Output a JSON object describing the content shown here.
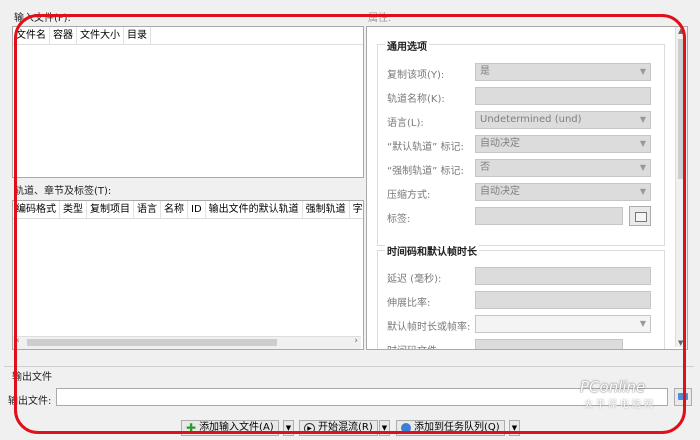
{
  "input_files": {
    "label": "输入文件(F):",
    "columns": [
      "文件名",
      "容器",
      "文件大小",
      "目录"
    ]
  },
  "tracks": {
    "label": "轨道、章节及标签(T):",
    "columns": [
      "编码格式",
      "类型",
      "复制项目",
      "语言",
      "名称",
      "ID",
      "输出文件的默认轨道",
      "强制轨道",
      "字"
    ]
  },
  "properties": {
    "label": "属性:",
    "general": {
      "title": "通用选项",
      "rows": [
        {
          "label": "复制该项(Y):",
          "value": "是",
          "dropdown": true
        },
        {
          "label": "轨道名称(K):",
          "value": "",
          "dropdown": false
        },
        {
          "label": "语言(L):",
          "value": "Undetermined (und)",
          "dropdown": true
        },
        {
          "label": "“默认轨道” 标记:",
          "value": "自动决定",
          "dropdown": true
        },
        {
          "label": "“强制轨道” 标记:",
          "value": "否",
          "dropdown": true
        },
        {
          "label": "压缩方式:",
          "value": "自动决定",
          "dropdown": true
        },
        {
          "label": "标签:",
          "value": "",
          "dropdown": false
        }
      ]
    },
    "timing": {
      "title": "时间码和默认帧时长",
      "rows": [
        {
          "label": "延迟 (毫秒):",
          "value": ""
        },
        {
          "label": "伸展比率:",
          "value": ""
        },
        {
          "label": "默认帧时长或帧率:",
          "value": ""
        },
        {
          "label": "时间码文件:",
          "value": ""
        }
      ]
    }
  },
  "output": {
    "group_label": "输出文件",
    "file_label": "输出文件:",
    "file_value": ""
  },
  "buttons": {
    "add_input": "添加输入文件(A)",
    "start_mux": "开始混流(R)",
    "add_queue": "添加到任务队列(Q)"
  },
  "watermark": {
    "brand": "PConline",
    "sub": "太平洋电脑网"
  }
}
